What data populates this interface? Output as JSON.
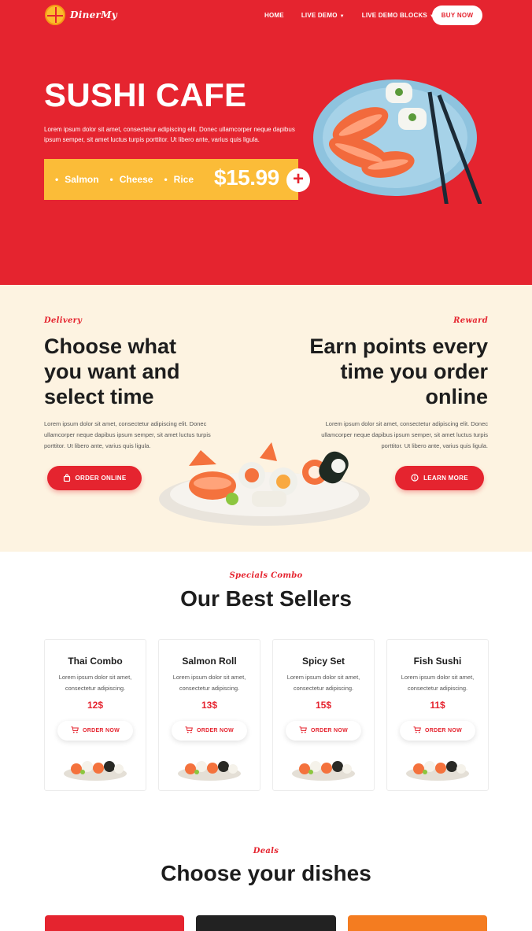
{
  "nav": {
    "logo_text": "DinerMy",
    "links": [
      {
        "label": "HOME",
        "has_dropdown": false
      },
      {
        "label": "LIVE DEMO",
        "has_dropdown": true
      },
      {
        "label": "LIVE DEMO BLOCKS",
        "has_dropdown": true
      }
    ],
    "buy_now": "BUY NOW"
  },
  "hero": {
    "title": "SUSHI CAFE",
    "description": "Lorem ipsum dolor sit amet, consectetur adipiscing elit. Donec ullamcorper neque dapibus ipsum semper, sit amet luctus turpis porttitor. Ut libero ante, varius quis ligula.",
    "ingredients": [
      "Salmon",
      "Cheese",
      "Rice"
    ],
    "price": "$15.99",
    "plus_label": "+"
  },
  "delivery": {
    "label": "Delivery",
    "title": "Choose what you want and select time",
    "text": "Lorem ipsum dolor sit amet, consectetur adipiscing elit. Donec ullamcorper neque dapibus ipsum semper, sit amet luctus turpis porttitor. Ut libero ante, varius quis ligula.",
    "button": "ORDER ONLINE"
  },
  "reward": {
    "label": "Reward",
    "title": "Earn points every time you order online",
    "text": "Lorem ipsum dolor sit amet, consectetur adipiscing elit. Donec ullamcorper neque dapibus ipsum semper, sit amet luctus turpis porttitor. Ut libero ante, varius quis ligula.",
    "button": "LEARN MORE"
  },
  "best_sellers": {
    "label": "Specials Combo",
    "title": "Our Best Sellers",
    "items": [
      {
        "name": "Thai Combo",
        "description": "Lorem ipsum dolor sit amet, consectetur adipiscing.",
        "price": "12$",
        "button": "ORDER NOW"
      },
      {
        "name": "Salmon Roll",
        "description": "Lorem ipsum dolor sit amet, consectetur adipiscing.",
        "price": "13$",
        "button": "ORDER NOW"
      },
      {
        "name": "Spicy Set",
        "description": "Lorem ipsum dolor sit amet, consectetur adipiscing.",
        "price": "15$",
        "button": "ORDER NOW"
      },
      {
        "name": "Fish Sushi",
        "description": "Lorem ipsum dolor sit amet, consectetur adipiscing.",
        "price": "11$",
        "button": "ORDER NOW"
      }
    ]
  },
  "deals": {
    "label": "Deals",
    "title": "Choose your dishes",
    "tile_colors": [
      "#e5242f",
      "#222222",
      "#f47c20"
    ]
  },
  "colors": {
    "primary": "#e5242f",
    "accent_yellow": "#fbbc38",
    "cream": "#fdf3e1",
    "dark": "#1d1d1d"
  },
  "icons": {
    "order_online": "bag-icon",
    "learn_more": "info-icon",
    "order_now": "cart-icon"
  }
}
